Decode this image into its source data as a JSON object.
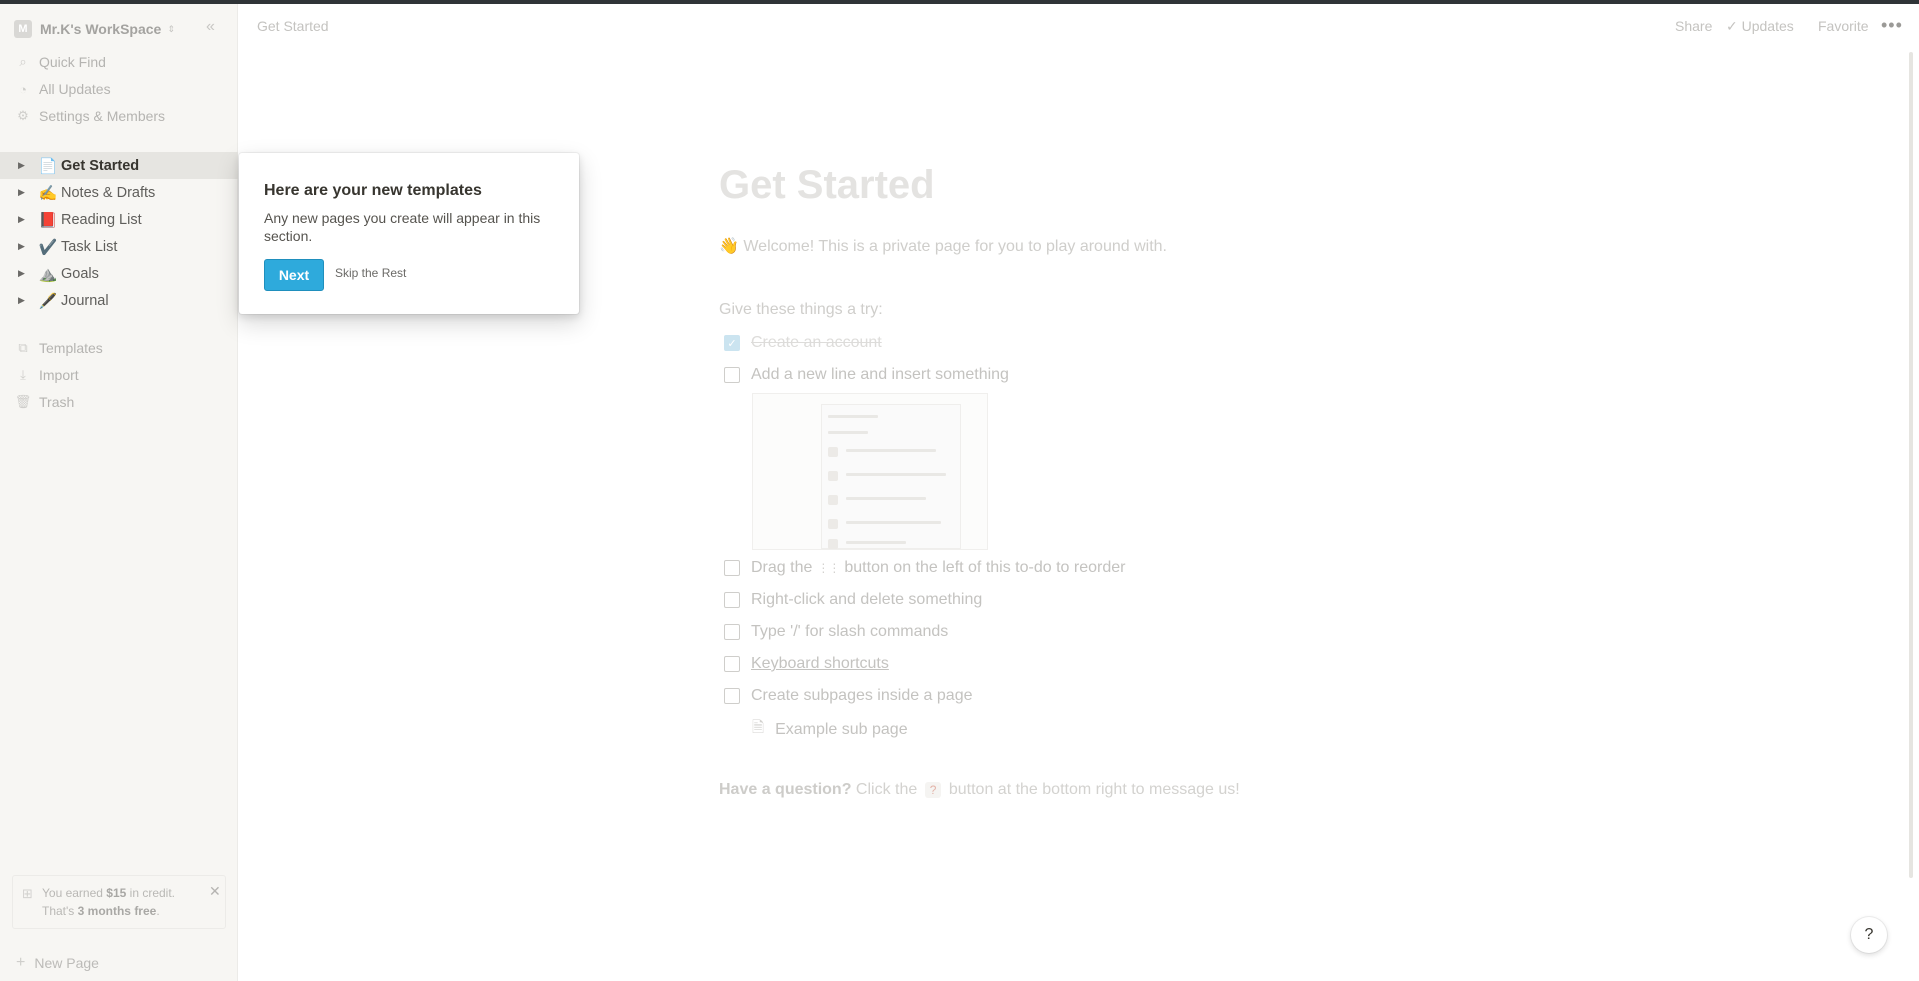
{
  "sidebar": {
    "workspace": {
      "initial": "M",
      "name": "Mr.K's WorkSpace",
      "caret": "⇕",
      "collapse": "«"
    },
    "nav": [
      {
        "icon": "search-icon",
        "glyph": "⌕",
        "label": "Quick Find"
      },
      {
        "icon": "clock-icon",
        "glyph": "◔",
        "label": "All Updates"
      },
      {
        "icon": "gear-icon",
        "glyph": "⚙",
        "label": "Settings & Members"
      }
    ],
    "pages": [
      {
        "emoji": "📄",
        "label": "Get Started",
        "active": true
      },
      {
        "emoji": "✍️",
        "label": "Notes & Drafts"
      },
      {
        "emoji": "📕",
        "label": "Reading List"
      },
      {
        "emoji": "✔️",
        "label": "Task List"
      },
      {
        "emoji": "⛰️",
        "label": "Goals"
      },
      {
        "emoji": "🖋️",
        "label": "Journal"
      }
    ],
    "tools": [
      {
        "icon": "templates-icon",
        "glyph": "⧉",
        "label": "Templates"
      },
      {
        "icon": "import-icon",
        "glyph": "⤓",
        "label": "Import"
      },
      {
        "icon": "trash-icon",
        "glyph": "🗑",
        "label": "Trash"
      }
    ],
    "credit": {
      "pre": "You earned ",
      "amount": "$15",
      "post": " in credit.",
      "line2_pre": "That's ",
      "line2_bold": "3 months free",
      "line2_post": "."
    },
    "new_page": "New Page"
  },
  "topbar": {
    "breadcrumb": "Get Started",
    "share": "Share",
    "updates": "Updates",
    "favorite": "Favorite",
    "more": "•••"
  },
  "main": {
    "title": "Get Started",
    "welcome": "👋 Welcome! This is a private page for you to play around with.",
    "subhead": "Give these things a try:",
    "todos": [
      {
        "text": "Create an account",
        "checked": true
      },
      {
        "text": "Add a new line and insert something"
      }
    ],
    "todo_drag": {
      "pre": "Drag the",
      "handle": "⋮⋮",
      "post": "button on the left of this to-do to reorder"
    },
    "todos2": [
      {
        "text": "Right-click and delete something"
      },
      {
        "text": "Type '/' for slash commands"
      },
      {
        "text": "Keyboard shortcuts",
        "link": true
      },
      {
        "text": "Create subpages inside a page"
      }
    ],
    "sub_page": "Example sub page",
    "question": {
      "bold": "Have a question?",
      "pre": " Click the ",
      "badge": "?",
      "post": " button at the bottom right to message us!"
    }
  },
  "popup": {
    "title": "Here are your new templates",
    "body": "Any new pages you create will appear in this section.",
    "next": "Next",
    "skip": "Skip the Rest"
  },
  "help": "?"
}
